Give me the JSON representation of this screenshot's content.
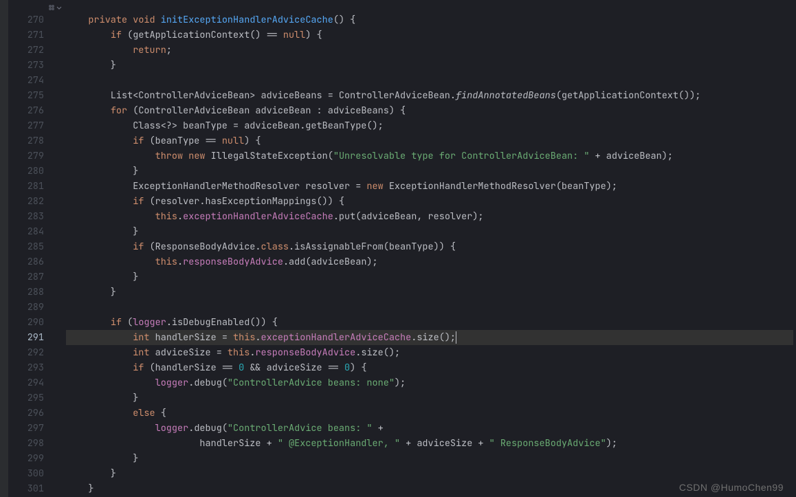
{
  "gutter": {
    "lines": [
      "270",
      "271",
      "272",
      "273",
      "274",
      "275",
      "276",
      "277",
      "278",
      "279",
      "280",
      "281",
      "282",
      "283",
      "284",
      "285",
      "286",
      "287",
      "288",
      "289",
      "290",
      "291",
      "292",
      "293",
      "294",
      "295",
      "296",
      "297",
      "298",
      "299",
      "300",
      "301"
    ],
    "current": "291"
  },
  "icons": {
    "clover": "clover-icon",
    "chevron": "chevron-down-icon"
  },
  "code": {
    "l270": {
      "indent": "    ",
      "kw1": "private",
      "sp1": " ",
      "kw2": "void",
      "sp2": " ",
      "method": "initExceptionHandlerAdviceCache",
      "rest": "() {"
    },
    "l271": {
      "pre": "        ",
      "kw": "if",
      "post": " (getApplicationContext() == ",
      "null": "null",
      "end": ") {"
    },
    "l272": {
      "pre": "            ",
      "kw": "return",
      "end": ";"
    },
    "l273": {
      "text": "        }"
    },
    "l274": {
      "text": ""
    },
    "l275": {
      "pre": "        List<ControllerAdviceBean> adviceBeans = ControllerAdviceBean.",
      "method": "findAnnotatedBeans",
      "end": "(getApplicationContext());"
    },
    "l276": {
      "pre": "        ",
      "kw": "for",
      "post": " (ControllerAdviceBean adviceBean : adviceBeans) {"
    },
    "l277": {
      "text": "            Class<?> beanType = adviceBean.getBeanType();"
    },
    "l278": {
      "pre": "            ",
      "kw": "if",
      "post": " (beanType == ",
      "null": "null",
      "end": ") {"
    },
    "l279": {
      "pre": "                ",
      "kw1": "throw",
      "sp": " ",
      "kw2": "new",
      "post": " IllegalStateException(",
      "str": "\"Unresolvable type for ControllerAdviceBean: \"",
      "end": " + adviceBean);"
    },
    "l280": {
      "text": "            }"
    },
    "l281": {
      "pre": "            ExceptionHandlerMethodResolver resolver = ",
      "kw": "new",
      "post": " ExceptionHandlerMethodResolver(beanType);"
    },
    "l282": {
      "pre": "            ",
      "kw": "if",
      "post": " (resolver.hasExceptionMappings()) {"
    },
    "l283": {
      "pre": "                ",
      "this": "this",
      "dot": ".",
      "field": "exceptionHandlerAdviceCache",
      "end": ".put(adviceBean, resolver);"
    },
    "l284": {
      "text": "            }"
    },
    "l285": {
      "pre": "            ",
      "kw": "if",
      "post": " (ResponseBodyAdvice.",
      "cls": "class",
      "end": ".isAssignableFrom(beanType)) {"
    },
    "l286": {
      "pre": "                ",
      "this": "this",
      "dot": ".",
      "field": "responseBodyAdvice",
      "end": ".add(adviceBean);"
    },
    "l287": {
      "text": "            }"
    },
    "l288": {
      "text": "        }"
    },
    "l289": {
      "text": ""
    },
    "l290": {
      "pre": "        ",
      "kw": "if",
      "post": " (",
      "logger": "logger",
      "end": ".isDebugEnabled()) {"
    },
    "l291": {
      "pre": "            ",
      "kw": "int",
      "post": " handlerSize = ",
      "this": "this",
      "dot": ".",
      "field": "exceptionHandlerAdviceCache",
      "end": ".size();"
    },
    "l292": {
      "pre": "            ",
      "kw": "int",
      "post": " adviceSize = ",
      "this": "this",
      "dot": ".",
      "field": "responseBodyAdvice",
      "end": ".size();"
    },
    "l293": {
      "pre": "            ",
      "kw": "if",
      "post": " (handlerSize == ",
      "n1": "0",
      "mid": " && adviceSize == ",
      "n2": "0",
      "end": ") {"
    },
    "l294": {
      "pre": "                ",
      "logger": "logger",
      "mid": ".debug(",
      "str": "\"ControllerAdvice beans: none\"",
      "end": ");"
    },
    "l295": {
      "text": "            }"
    },
    "l296": {
      "pre": "            ",
      "kw": "else",
      "end": " {"
    },
    "l297": {
      "pre": "                ",
      "logger": "logger",
      "mid": ".debug(",
      "str": "\"ControllerAdvice beans: \"",
      "end": " +"
    },
    "l298": {
      "pre": "                        handlerSize + ",
      "str1": "\" @ExceptionHandler, \"",
      "mid": " + adviceSize + ",
      "str2": "\" ResponseBodyAdvice\"",
      "end": ");"
    },
    "l299": {
      "text": "            }"
    },
    "l300": {
      "text": "        }"
    },
    "l301": {
      "text": "    }"
    }
  },
  "watermark": "CSDN @HumoChen99"
}
